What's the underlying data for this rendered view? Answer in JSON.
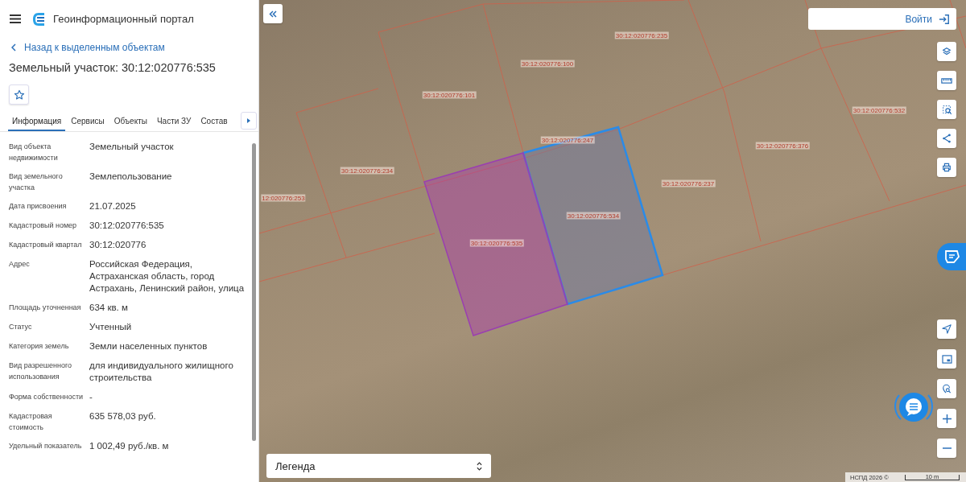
{
  "header": {
    "title": "Геоинформационный портал"
  },
  "back_link": "Назад к выделенным объектам",
  "object_title": "Земельный участок: 30:12:020776:535",
  "tabs": [
    {
      "label": "Информация",
      "selected": true
    },
    {
      "label": "Сервисы",
      "selected": false
    },
    {
      "label": "Объекты",
      "selected": false
    },
    {
      "label": "Части ЗУ",
      "selected": false
    },
    {
      "label": "Состав",
      "selected": false
    }
  ],
  "properties": [
    {
      "label": "Вид объекта недвижимости",
      "value": "Земельный участок"
    },
    {
      "label": "Вид земельного участка",
      "value": "Землепользование"
    },
    {
      "label": "Дата присвоения",
      "value": "21.07.2025"
    },
    {
      "label": "Кадастровый номер",
      "value": "30:12:020776:535"
    },
    {
      "label": "Кадастровый квартал",
      "value": "30:12:020776"
    },
    {
      "label": "Адрес",
      "value": "Российская Федерация, Астраханская область, город Астрахань, Ленинский район, улица"
    },
    {
      "label": "Площадь уточненная",
      "value": "634 кв. м"
    },
    {
      "label": "Статус",
      "value": "Учтенный"
    },
    {
      "label": "Категория земель",
      "value": "Земли населенных пунктов"
    },
    {
      "label": "Вид разрешенного использования",
      "value": "для индивидуального жилищного строительства"
    },
    {
      "label": "Форма собственности",
      "value": "-"
    },
    {
      "label": "Кадастровая стоимость",
      "value": "635 578,03 руб."
    },
    {
      "label": "Удельный показатель",
      "value": "1 002,49 руб./кв. м"
    }
  ],
  "map": {
    "login_button": "Войти",
    "parcels": [
      {
        "label": "30:12:020776:235",
        "kind": "plain"
      },
      {
        "label": "30:12:020776:100",
        "kind": "plain"
      },
      {
        "label": "30:12:020776:101",
        "kind": "plain"
      },
      {
        "label": "30:12:020776:532",
        "kind": "plain"
      },
      {
        "label": "30:12:020776:247",
        "kind": "plain"
      },
      {
        "label": "30:12:020776:376",
        "kind": "plain"
      },
      {
        "label": "30:12:020776:234",
        "kind": "plain"
      },
      {
        "label": "30:12:020776:237",
        "kind": "plain"
      },
      {
        "label": "12:020776:253",
        "kind": "plain"
      },
      {
        "label": "30:12:020776:534",
        "kind": "highlighted"
      },
      {
        "label": "30:12:020776:535",
        "kind": "selected"
      }
    ],
    "legend": {
      "label": "Легенда"
    },
    "attribution": "НСПД 2026 ©",
    "scale": "10 m"
  }
}
